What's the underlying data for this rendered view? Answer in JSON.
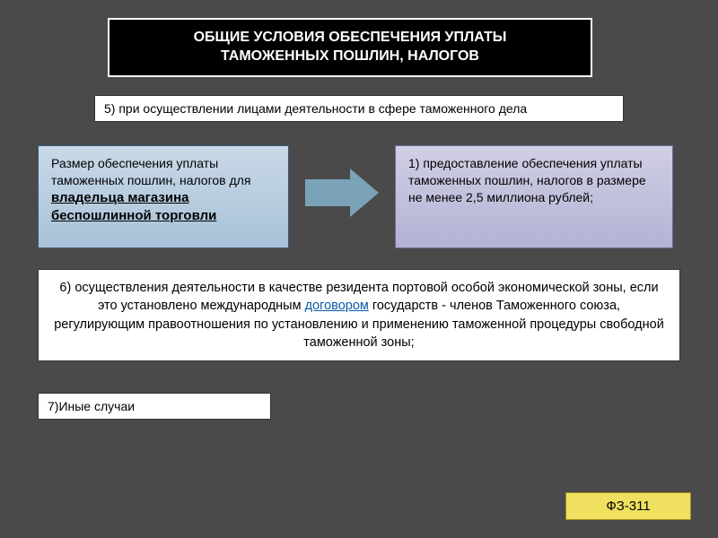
{
  "title": {
    "line1": "ОБЩИЕ УСЛОВИЯ ОБЕСПЕЧЕНИЯ УПЛАТЫ",
    "line2": "ТАМОЖЕННЫХ ПОШЛИН, НАЛОГОВ"
  },
  "item5": "5) при осуществлении лицами деятельности в сфере таможенного дела",
  "left_box": {
    "prefix": "Размер обеспечения уплаты таможенных пошлин, налогов для ",
    "owner": "владельца магазина беспошлинной торговли"
  },
  "right_box": "1) предоставление обеспечения уплаты таможенных пошлин, налогов в размере не менее 2,5 миллиона рублей;",
  "item6": {
    "pre": "6) осуществления деятельности в качестве резидента портовой особой экономической зоны, если это установлено  международным ",
    "link": "договором",
    "post": " государств - членов Таможенного союза, регулирующим правоотношения по установлению и применению таможенной процедуры свободной таможенной зоны;"
  },
  "item7": "7)Иные случаи",
  "fz": "ФЗ-311"
}
